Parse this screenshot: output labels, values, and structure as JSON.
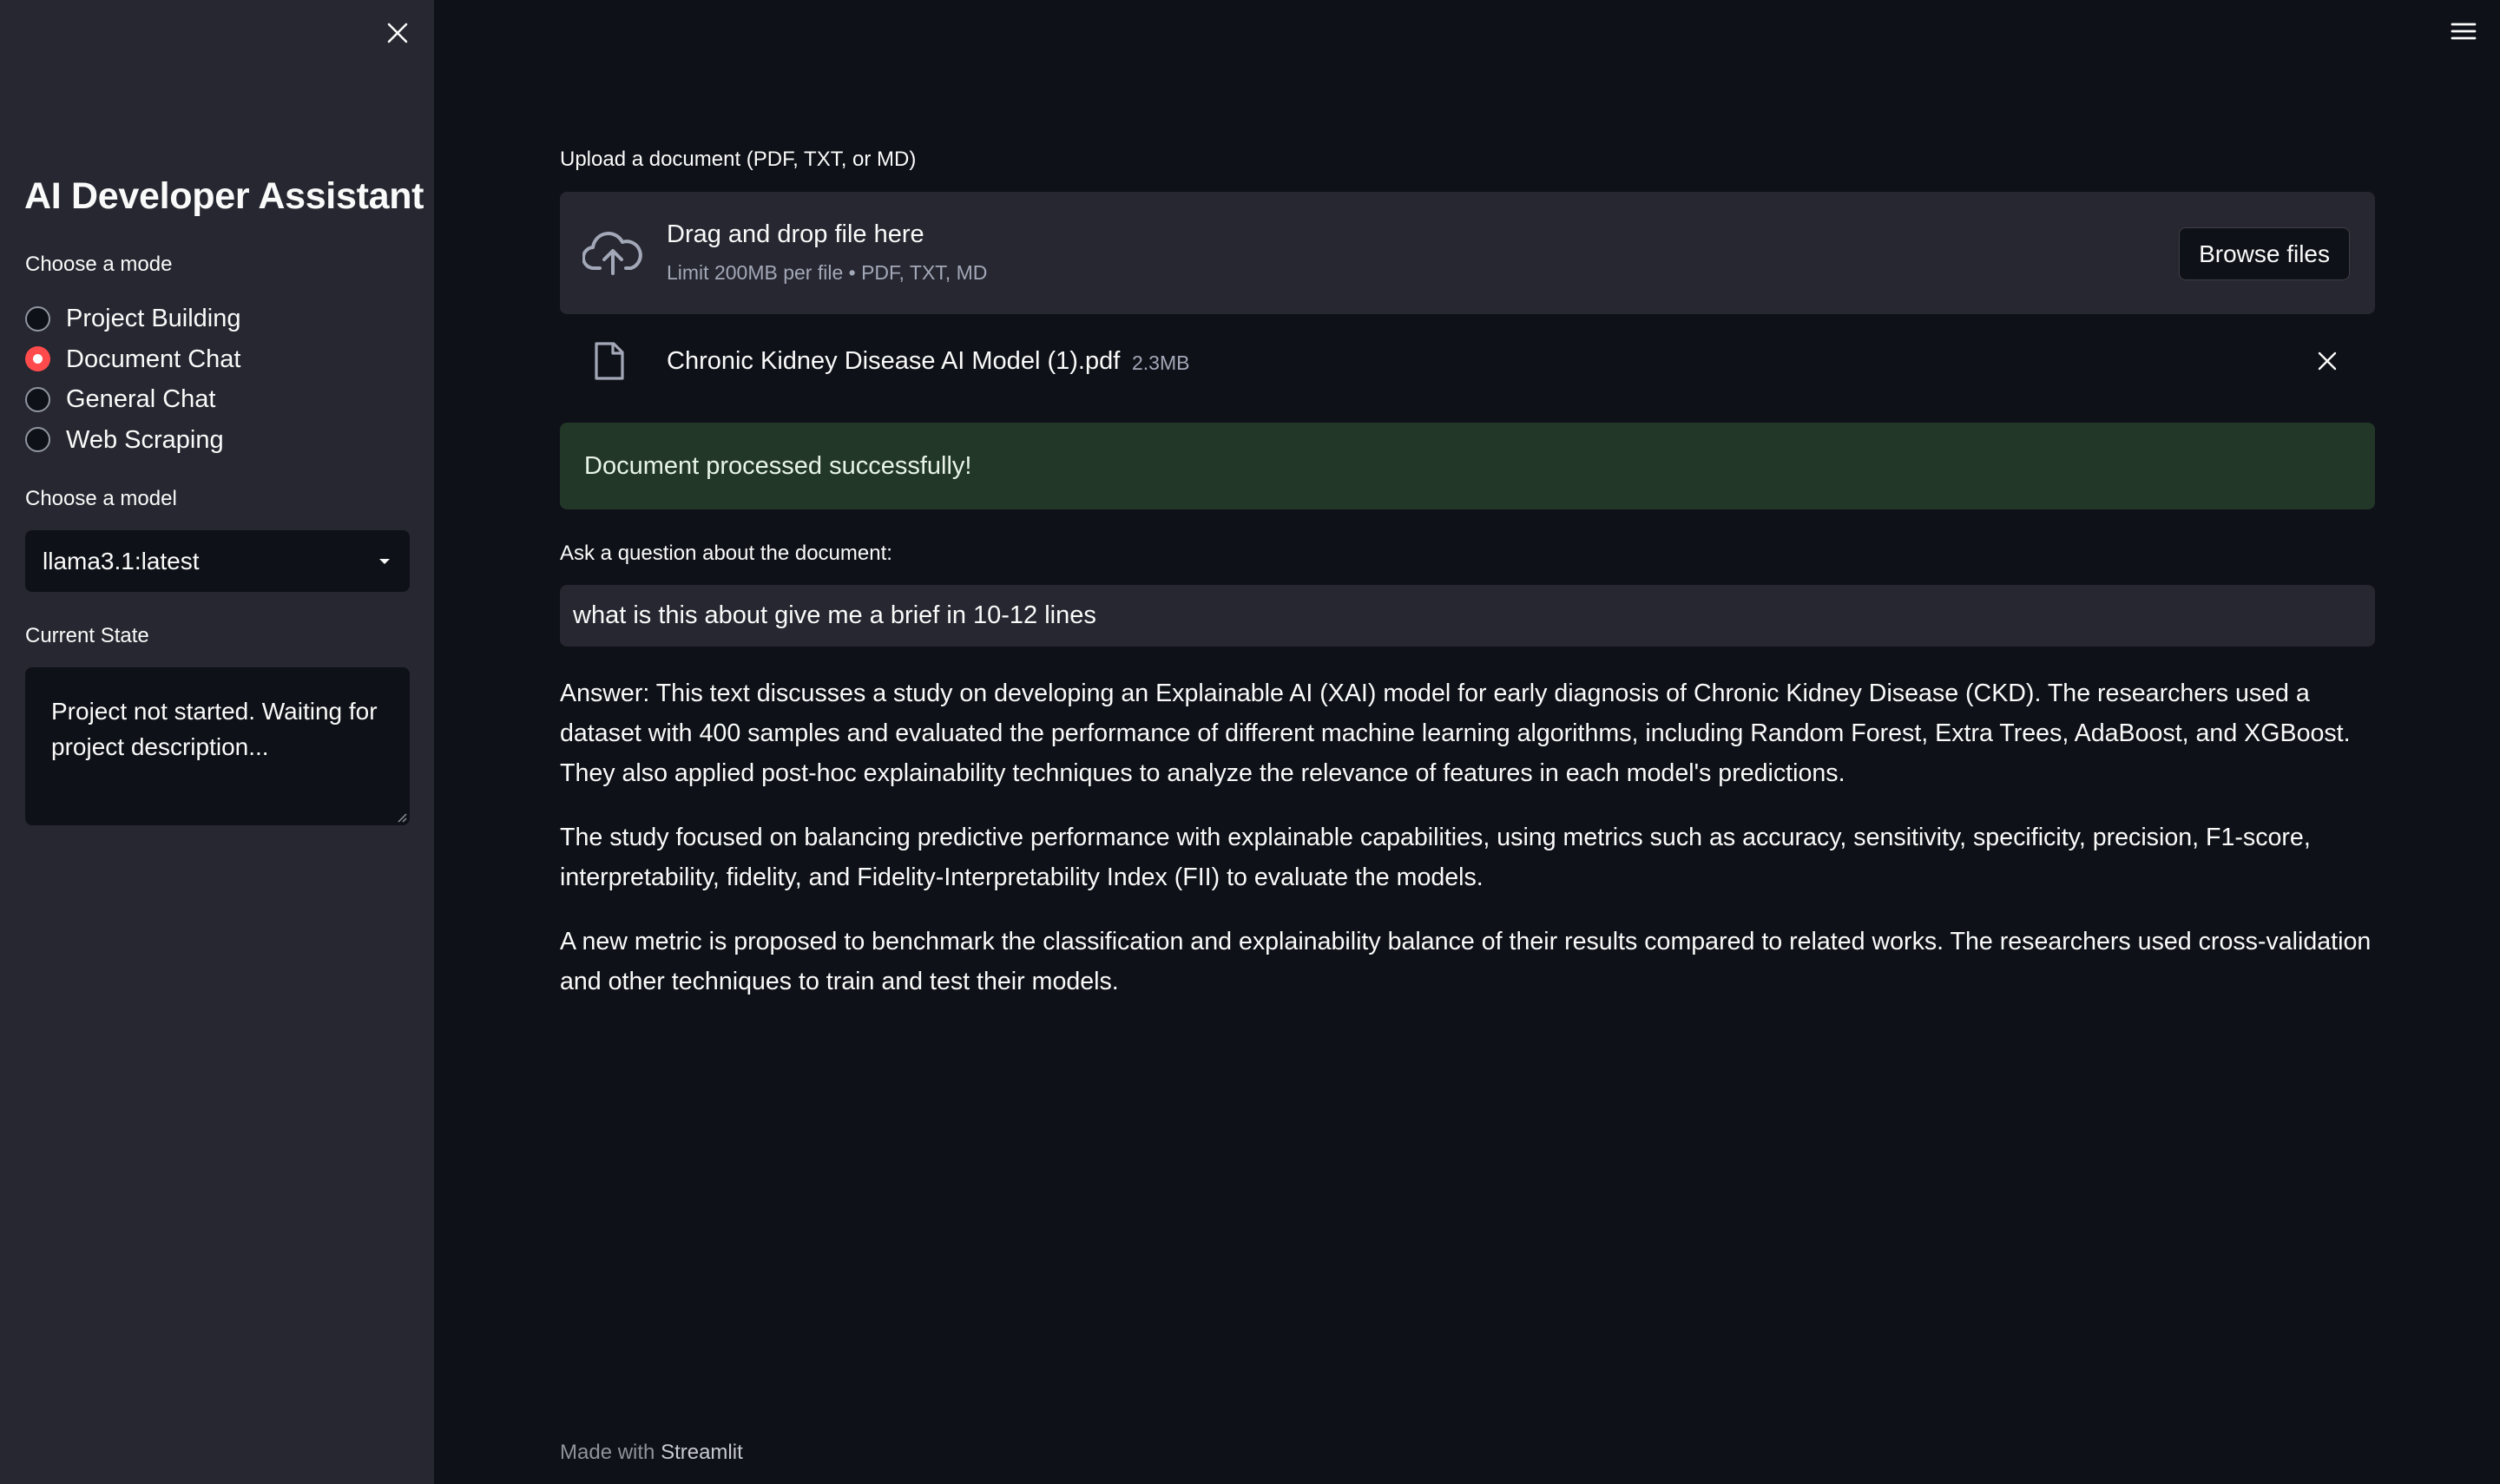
{
  "sidebar": {
    "title": "AI Developer Assistant",
    "mode_label": "Choose a mode",
    "modes": [
      {
        "label": "Project Building",
        "selected": false
      },
      {
        "label": "Document Chat",
        "selected": true
      },
      {
        "label": "General Chat",
        "selected": false
      },
      {
        "label": "Web Scraping",
        "selected": false
      }
    ],
    "model_label": "Choose a model",
    "model_value": "llama3.1:latest",
    "state_label": "Current State",
    "state_value": "Project not started. Waiting for project description..."
  },
  "upload": {
    "label": "Upload a document (PDF, TXT, or MD)",
    "drop_title": "Drag and drop file here",
    "drop_limit": "Limit 200MB per file • PDF, TXT, MD",
    "browse_label": "Browse files",
    "file_name": "Chronic Kidney Disease AI Model (1).pdf",
    "file_size": "2.3MB"
  },
  "status": {
    "success_message": "Document processed successfully!"
  },
  "question": {
    "label": "Ask a question about the document:",
    "value": "what is this about give me a brief in 10-12 lines"
  },
  "answer": {
    "paragraphs": [
      "Answer: This text discusses a study on developing an Explainable AI (XAI) model for early diagnosis of Chronic Kidney Disease (CKD). The researchers used a dataset with 400 samples and evaluated the performance of different machine learning algorithms, including Random Forest, Extra Trees, AdaBoost, and XGBoost. They also applied post-hoc explainability techniques to analyze the relevance of features in each model's predictions.",
      "The study focused on balancing predictive performance with explainable capabilities, using metrics such as accuracy, sensitivity, specificity, precision, F1-score, interpretability, fidelity, and Fidelity-Interpretability Index (FII) to evaluate the models.",
      "A new metric is proposed to benchmark the classification and explainability balance of their results compared to related works. The researchers used cross-validation and other techniques to train and test their models."
    ]
  },
  "footer": {
    "prefix": "Made with",
    "brand": "Streamlit"
  },
  "colors": {
    "background": "#0e1117",
    "sidebar": "#262730",
    "accent": "#ff4b4b",
    "success_bg": "#223728"
  },
  "icons": {
    "sidebar_close": "close-icon",
    "menu": "hamburger-menu-icon",
    "upload": "cloud-upload-icon",
    "file": "file-icon",
    "remove_file": "close-icon",
    "select_caret": "caret-down-icon"
  }
}
